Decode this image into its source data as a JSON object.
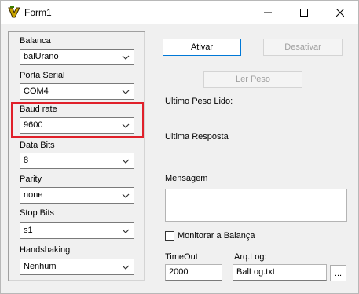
{
  "window": {
    "title": "Form1"
  },
  "left": {
    "balanca": {
      "label": "Balanca",
      "value": "balUrano"
    },
    "porta_serial": {
      "label": "Porta Serial",
      "value": "COM4"
    },
    "baud_rate": {
      "label": "Baud rate",
      "value": "9600"
    },
    "data_bits": {
      "label": "Data Bits",
      "value": "8"
    },
    "parity": {
      "label": "Parity",
      "value": "none"
    },
    "stop_bits": {
      "label": "Stop Bits",
      "value": "s1"
    },
    "handshaking": {
      "label": "Handshaking",
      "value": "Nenhum"
    }
  },
  "right": {
    "ativar": "Ativar",
    "desativar": "Desativar",
    "ler_peso": "Ler Peso",
    "ultimo_peso": "Ultimo Peso Lido:",
    "ultima_resposta": "Ultima Resposta",
    "mensagem": "Mensagem",
    "monitorar": "Monitorar a Balança",
    "timeout_label": "TimeOut",
    "timeout_value": "2000",
    "arqlog_label": "Arq.Log:",
    "arqlog_value": "BalLog.txt",
    "browse": "..."
  },
  "colors": {
    "highlight": "#e0202a",
    "focus": "#0078d7"
  }
}
